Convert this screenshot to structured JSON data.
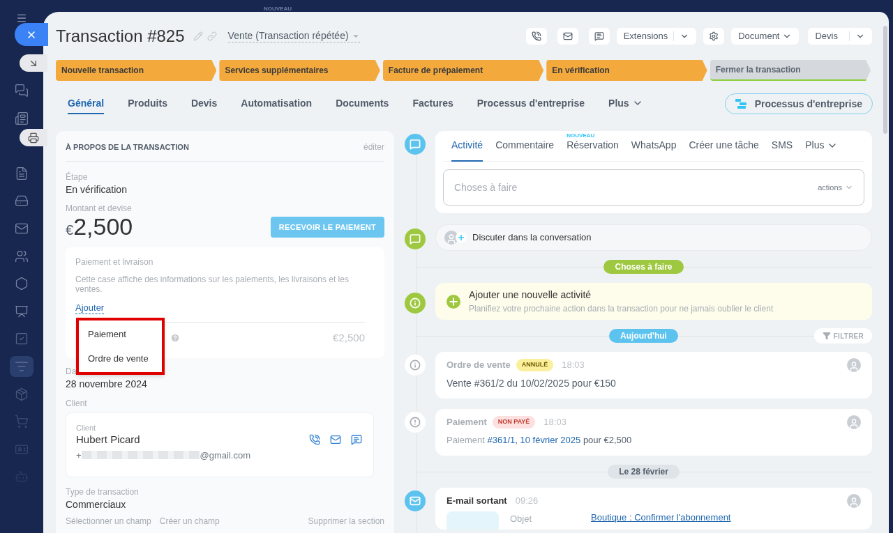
{
  "background": {
    "badge": "NOUVEAU"
  },
  "sidebar": {
    "items": [
      {
        "selected": false
      },
      {
        "selected": false
      },
      {
        "selected": false
      },
      {
        "selected": false
      },
      {
        "selected": false
      },
      {
        "selected": false
      },
      {
        "selected": false
      },
      {
        "selected": false
      },
      {
        "selected": false
      },
      {
        "selected": true
      },
      {
        "selected": false
      },
      {
        "selected": false
      },
      {
        "selected": false
      },
      {
        "selected": false
      }
    ]
  },
  "header": {
    "title": "Transaction #825",
    "category": "Vente (Transaction répétée)",
    "extensions": "Extensions",
    "document": "Document",
    "quote": "Devis"
  },
  "stages": [
    {
      "label": "Nouvelle transaction",
      "reached": true
    },
    {
      "label": "Services supplémentaires",
      "reached": true
    },
    {
      "label": "Facture de prépaiement",
      "reached": true
    },
    {
      "label": "En vérification",
      "reached": true
    },
    {
      "label": "Fermer la transaction",
      "reached": false
    }
  ],
  "tabs": [
    {
      "label": "Général",
      "selected": true
    },
    {
      "label": "Produits",
      "selected": false
    },
    {
      "label": "Devis",
      "selected": false
    },
    {
      "label": "Automatisation",
      "selected": false
    },
    {
      "label": "Documents",
      "selected": false
    },
    {
      "label": "Factures",
      "selected": false
    },
    {
      "label": "Processus d'entreprise",
      "selected": false
    },
    {
      "label": "Plus",
      "selected": false,
      "kind": "more"
    }
  ],
  "process_button": "Processus d'entreprise",
  "about": {
    "heading": "À PROPOS DE LA TRANSACTION",
    "edit": "éditer",
    "stage_label": "Étape",
    "stage": "En vérification",
    "amount_label": "Montant et devise",
    "currency": "€",
    "amount": "2,500",
    "pay_button": "RECEVOIR LE PAIEMENT",
    "payment_box": {
      "title": "Paiement et livraison",
      "description": "Cette case affiche des informations sur les paiements, les livraisons et les ventes.",
      "add": "Ajouter",
      "total": "€2,500"
    },
    "menu": [
      {
        "label": "Paiement"
      },
      {
        "label": "Ordre de vente"
      }
    ],
    "date_label": "Da",
    "date": "28 novembre 2024",
    "client_label": "Client",
    "client": {
      "label": "Client",
      "name": "Hubert Picard",
      "phone_prefix": "+",
      "email_suffix": "@gmail.com"
    },
    "type_label": "Type de transaction",
    "type": "Commerciaux",
    "footer_links": [
      "Sélectionner un champ",
      "Créer un champ",
      "Supprimer la section"
    ]
  },
  "composer": {
    "tabs": [
      {
        "label": "Activité",
        "selected": true
      },
      {
        "label": "Commentaire",
        "selected": false
      },
      {
        "label": "Réservation",
        "selected": false,
        "badge": "NOUVEAU"
      },
      {
        "label": "WhatsApp",
        "selected": false
      },
      {
        "label": "Créer une tâche",
        "selected": false
      },
      {
        "label": "SMS",
        "selected": false
      },
      {
        "label": "Plus",
        "selected": false,
        "kind": "more"
      }
    ],
    "placeholder": "Choses à faire",
    "actions": "actions"
  },
  "chat": {
    "label": "Discuter dans la conversation"
  },
  "timeline": [
    {
      "kind": "divider",
      "label": "Choses à faire",
      "color": "#9dc83f"
    },
    {
      "kind": "add",
      "title": "Ajouter une nouvelle activité",
      "text": "Planifiez votre prochaine action dans la transaction pour ne jamais oublier le client"
    },
    {
      "kind": "divider",
      "label": "Aujourd'hui",
      "color": "#5cc3ef",
      "filter": "FILTRER"
    },
    {
      "kind": "order",
      "title": "Ordre de vente",
      "badge": {
        "label": "ANNULÉ",
        "color": "#fbef9b"
      },
      "time": "18:03",
      "text": "Vente #361/2 du 10/02/2025 pour €150"
    },
    {
      "kind": "payment",
      "title": "Paiement",
      "badge": {
        "label": "NON PAYÉ",
        "color": "#fde0e0"
      },
      "time": "18:03",
      "prefix": "Paiement",
      "link": "#361/1, 10 février 2025",
      "suffix": "pour €2,500"
    },
    {
      "kind": "divider",
      "label": "Le 28 février",
      "color": "#dfe4e8"
    },
    {
      "kind": "email",
      "title": "E-mail sortant",
      "time": "09:26",
      "subject_label": "Objet",
      "subject": "Boutique : Confirmer l'abonnement"
    }
  ]
}
